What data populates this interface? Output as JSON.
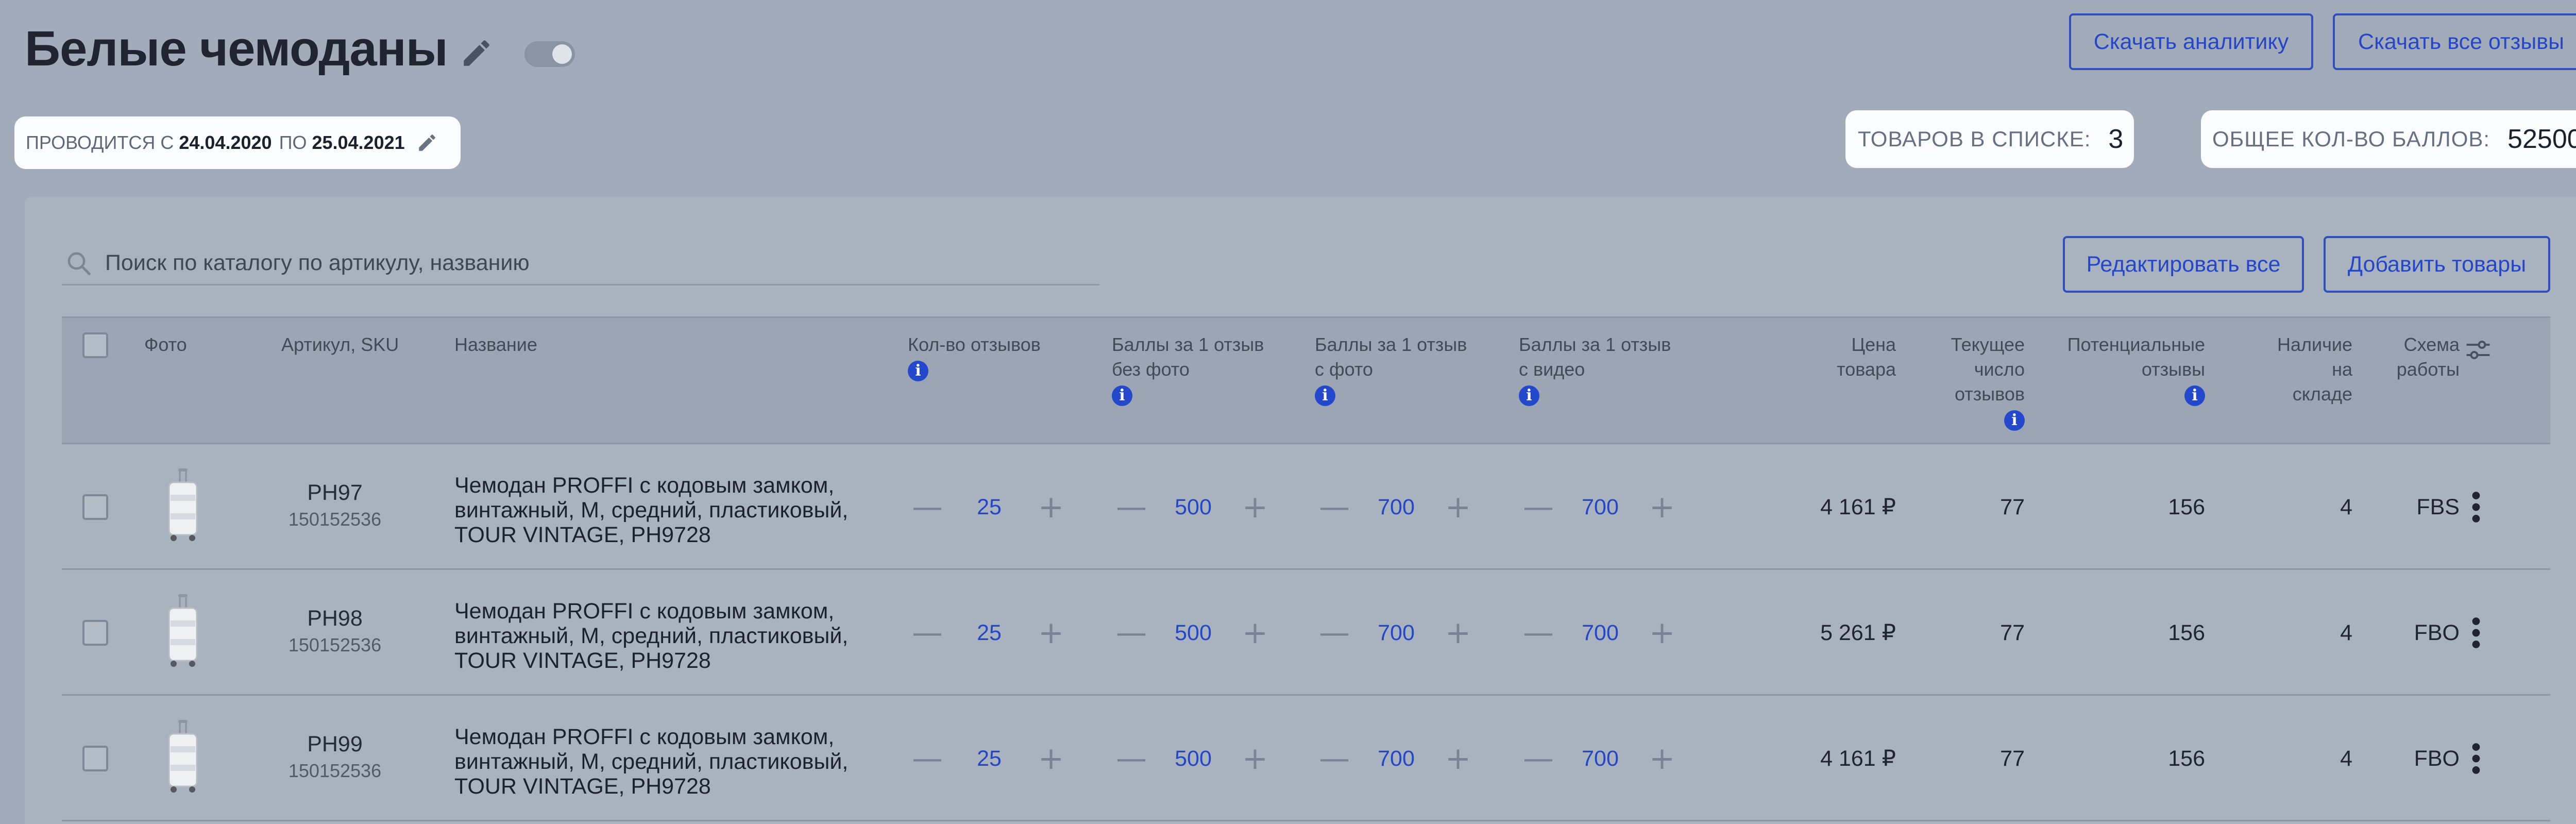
{
  "header": {
    "title": "Белые чемоданы",
    "download_analytics": "Скачать аналитику",
    "download_reviews": "Скачать все отзывы"
  },
  "period": {
    "prefix": "ПРОВОДИТСЯ С",
    "start": "24.04.2020",
    "mid": "ПО",
    "end": "25.04.2021"
  },
  "stats": {
    "goods_label": "ТОВАРОВ В СПИСКЕ:",
    "goods_value": "3",
    "points_label": "ОБЩЕЕ КОЛ-ВО БАЛЛОВ:",
    "points_value": "52500"
  },
  "toolbar": {
    "search_placeholder": "Поиск по каталогу по артикулу, названию",
    "edit_all": "Редактировать все",
    "add_goods": "Добавить товары"
  },
  "columns": {
    "photo": "Фото",
    "sku": "Артикул, SKU",
    "name": "Название",
    "reviews_count": "Кол-во отзывов",
    "points_nophoto_1": "Баллы за 1 отзыв",
    "points_nophoto_2": "без фото",
    "points_photo_1": "Баллы за 1 отзыв",
    "points_photo_2": "с фото",
    "points_video_1": "Баллы за 1 отзыв",
    "points_video_2": "с видео",
    "price_1": "Цена",
    "price_2": "товара",
    "current_1": "Текущее",
    "current_2": "число",
    "current_3": "отзывов",
    "potential_1": "Потенциальные",
    "potential_2": "отзывы",
    "stock_1": "Наличие",
    "stock_2": "на",
    "stock_3": "складе",
    "scheme_1": "Схема",
    "scheme_2": "работы",
    "info_glyph": "i"
  },
  "controls": {
    "minus": "—",
    "plus": "+"
  },
  "rows": [
    {
      "article": "PH97",
      "sku": "150152536",
      "name": "Чемодан PROFFI с кодовым замком, винтажный, M, средний, пластиковый, TOUR VINTAGE, PH9728",
      "reviews": "25",
      "points_nophoto": "500",
      "points_photo": "700",
      "points_video": "700",
      "price": "4 161 ₽",
      "current_reviews": "77",
      "potential": "156",
      "stock": "4",
      "scheme": "FBS"
    },
    {
      "article": "PH98",
      "sku": "150152536",
      "name": "Чемодан PROFFI с кодовым замком, винтажный, M, средний, пластиковый, TOUR VINTAGE, PH9728",
      "reviews": "25",
      "points_nophoto": "500",
      "points_photo": "700",
      "points_video": "700",
      "price": "5 261 ₽",
      "current_reviews": "77",
      "potential": "156",
      "stock": "4",
      "scheme": "FBO"
    },
    {
      "article": "PH99",
      "sku": "150152536",
      "name": "Чемодан PROFFI с кодовым замком, винтажный, M, средний, пластиковый, TOUR VINTAGE, PH9728",
      "reviews": "25",
      "points_nophoto": "500",
      "points_photo": "700",
      "points_video": "700",
      "price": "4 161 ₽",
      "current_reviews": "77",
      "potential": "156",
      "stock": "4",
      "scheme": "FBO"
    }
  ],
  "colors": {
    "accent": "#2547c7",
    "background": "#a2abb9"
  }
}
